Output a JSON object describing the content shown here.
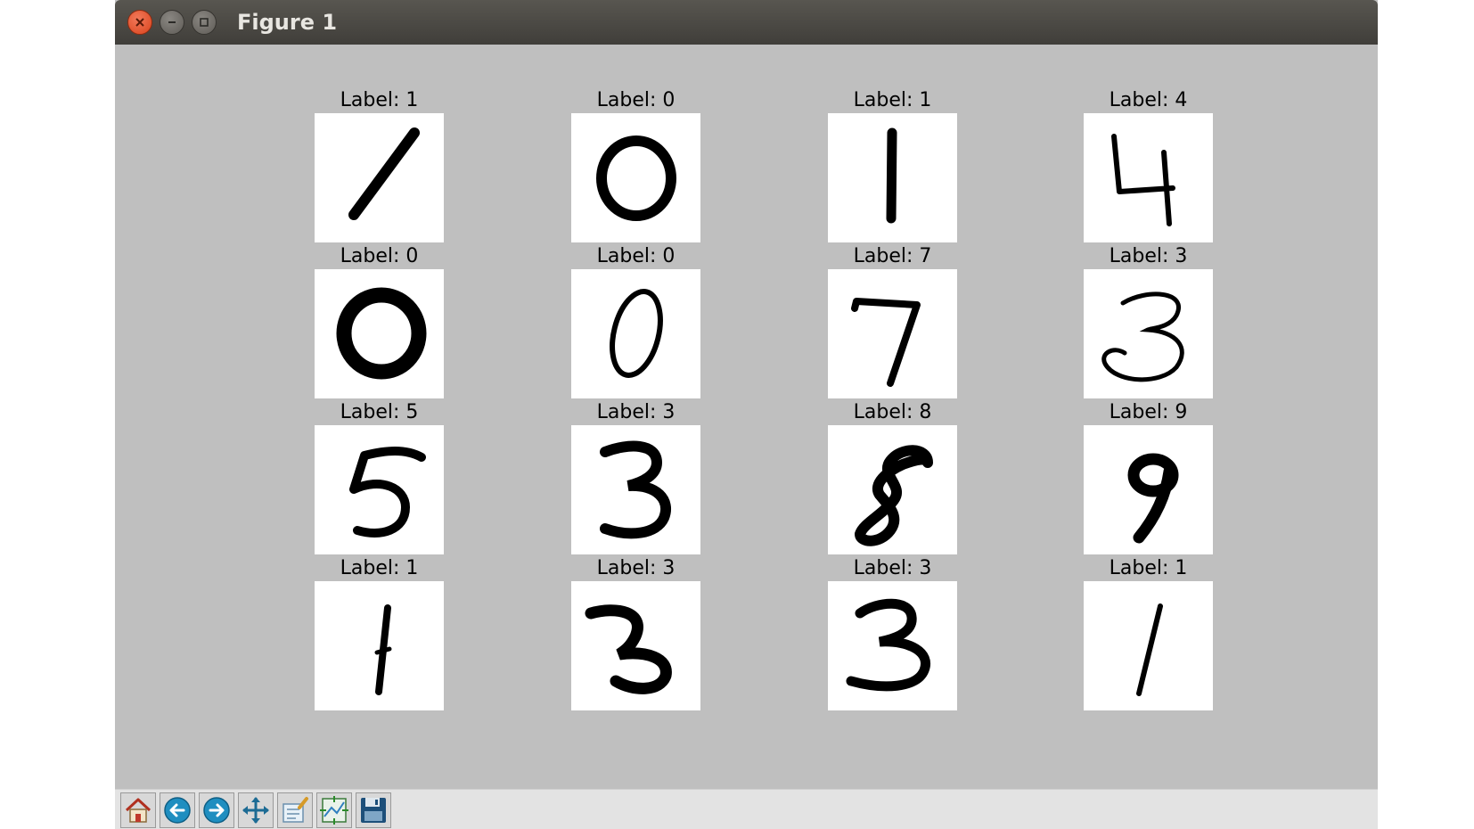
{
  "window": {
    "title": "Figure 1"
  },
  "grid": [
    {
      "label": "Label: 1",
      "digit": "1"
    },
    {
      "label": "Label: 0",
      "digit": "0"
    },
    {
      "label": "Label: 1",
      "digit": "1"
    },
    {
      "label": "Label: 4",
      "digit": "4"
    },
    {
      "label": "Label: 0",
      "digit": "0"
    },
    {
      "label": "Label: 0",
      "digit": "0"
    },
    {
      "label": "Label: 7",
      "digit": "7"
    },
    {
      "label": "Label: 3",
      "digit": "3"
    },
    {
      "label": "Label: 5",
      "digit": "5"
    },
    {
      "label": "Label: 3",
      "digit": "3"
    },
    {
      "label": "Label: 8",
      "digit": "8"
    },
    {
      "label": "Label: 9",
      "digit": "9"
    },
    {
      "label": "Label: 1",
      "digit": "1"
    },
    {
      "label": "Label: 3",
      "digit": "3"
    },
    {
      "label": "Label: 3",
      "digit": "3"
    },
    {
      "label": "Label: 1",
      "digit": "1"
    }
  ],
  "toolbar": {
    "buttons": [
      {
        "icon": "home-icon"
      },
      {
        "icon": "back-arrow-icon"
      },
      {
        "icon": "forward-arrow-icon"
      },
      {
        "icon": "pan-move-icon"
      },
      {
        "icon": "zoom-rect-icon"
      },
      {
        "icon": "subplots-config-icon"
      },
      {
        "icon": "save-floppy-icon"
      }
    ]
  },
  "colors": {
    "titlebar": "#403e3a",
    "close_button": "#e0502a",
    "figure_background": "#bfbfbf",
    "toolbar_background": "#e3e3e3"
  }
}
